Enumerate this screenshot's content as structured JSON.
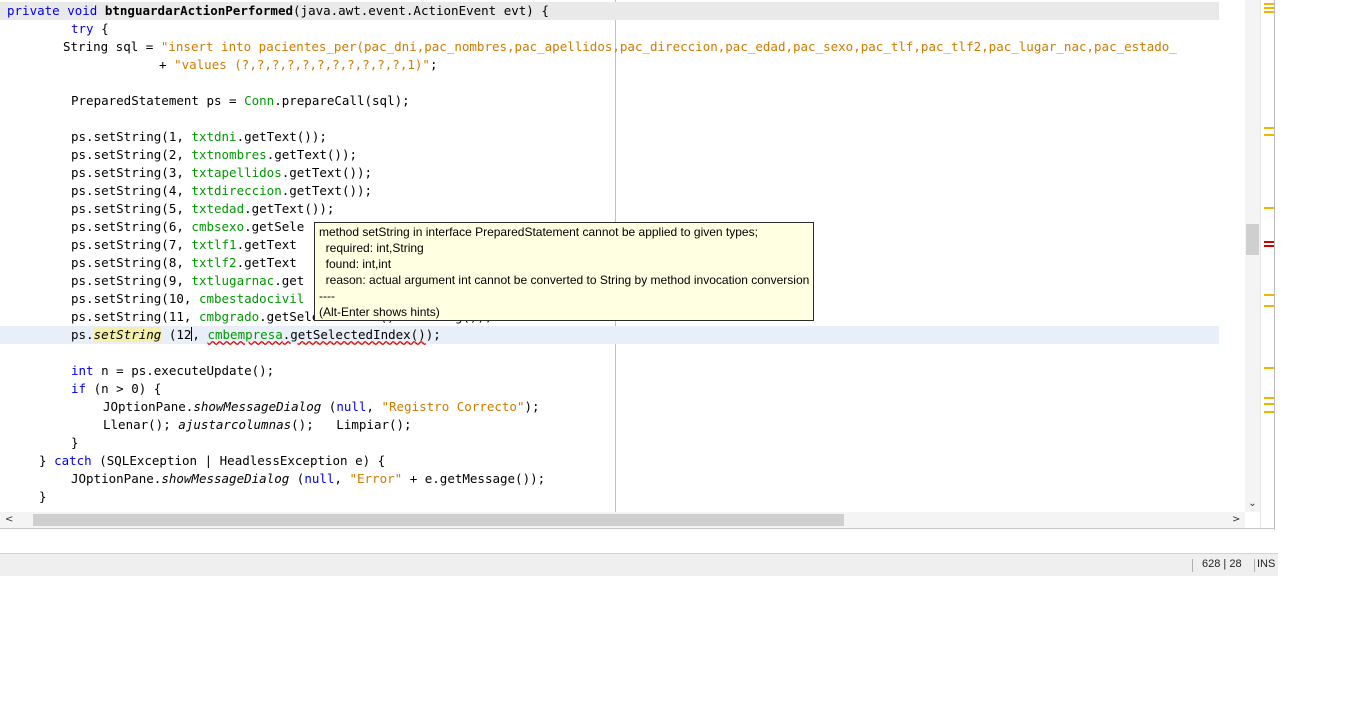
{
  "code": {
    "line1": {
      "kw1": "private",
      "kw2": "void",
      "method": "btnguardarActionPerformed",
      "rest": "(java.awt.event.ActionEvent evt) {"
    },
    "line2": {
      "kw": "try",
      "rest": " {"
    },
    "line3": {
      "plain": "String sql = ",
      "str": "\"insert into pacientes_per(pac_dni,pac_nombres,pac_apellidos,pac_direccion,pac_edad,pac_sexo,pac_tlf,pac_tlf2,pac_lugar_nac,pac_estado_"
    },
    "line4": {
      "plain": "+ ",
      "str": "\"values (?,?,?,?,?,?,?,?,?,?,?,1)\"",
      "end": ";"
    },
    "line6": {
      "pre": "PreparedStatement ps = ",
      "fld": "Conn",
      "post": ".prepareCall(sql);"
    },
    "stmts": [
      {
        "pre": "ps.setString(1, ",
        "fld": "txtdni",
        "post": ".getText());"
      },
      {
        "pre": "ps.setString(2, ",
        "fld": "txtnombres",
        "post": ".getText());"
      },
      {
        "pre": "ps.setString(3, ",
        "fld": "txtapellidos",
        "post": ".getText());"
      },
      {
        "pre": "ps.setString(4, ",
        "fld": "txtdireccion",
        "post": ".getText());"
      },
      {
        "pre": "ps.setString(5, ",
        "fld": "txtedad",
        "post": ".getText());"
      },
      {
        "pre": "ps.setString(6, ",
        "fld": "cmbsexo",
        "post": ".getSele"
      },
      {
        "pre": "ps.setString(7, ",
        "fld": "txtlf1",
        "post": ".getText"
      },
      {
        "pre": "ps.setString(8, ",
        "fld": "txtlf2",
        "post": ".getText"
      },
      {
        "pre": "ps.setString(9, ",
        "fld": "txtlugarnac",
        "post": ".get"
      },
      {
        "pre": "ps.setString(10, ",
        "fld": "cmbestadocivil",
        "post": ""
      },
      {
        "pre": "ps.setString(11, ",
        "fld": "cmbgrado",
        "post": ".getSelectedItem().toString());"
      }
    ],
    "line20": {
      "pre": "ps.",
      "method": "setString",
      "args": " (12",
      "comma": ", ",
      "fld": "cmbempresa",
      "err": ".getSelectedIndex()",
      "end": ");"
    },
    "line22": {
      "kw": "int",
      "rest": " n = ps.executeUpdate();"
    },
    "line23": {
      "kw": "if",
      "rest": " (n > 0) {"
    },
    "line24": {
      "pre": "JOptionPane.",
      "it": "showMessageDialog",
      "mid": " (",
      "kw": "null",
      "comma": ", ",
      "str": "\"Registro Correcto\"",
      "end": ");"
    },
    "line25": {
      "pre": "Llenar(); ",
      "it": "ajustarcolumnas",
      "post": "();   Limpiar();"
    },
    "line26": "}",
    "line27": {
      "pre": "} ",
      "kw": "catch",
      "post": " (SQLException | HeadlessException e) {"
    },
    "line28": {
      "pre": "JOptionPane.",
      "it": "showMessageDialog",
      "mid": " (",
      "kw": "null",
      "comma": ", ",
      "str": "\"Error\"",
      "end": " + e.getMessage());"
    },
    "line29": "}"
  },
  "tooltip": {
    "line1": "method setString in interface PreparedStatement cannot be applied to given types;",
    "line2": "  required: int,String",
    "line3": "  found: int,int",
    "line4": "  reason: actual argument int cannot be converted to String by method invocation conversion",
    "line5": "----",
    "line6": "(Alt-Enter shows hints)"
  },
  "status": {
    "position": "628 | 28",
    "mode": "INS"
  },
  "scroll": {
    "left": "<",
    "right": ">",
    "down": "⌄"
  },
  "colors": {
    "keyword": "#0000e6",
    "string": "#ce7b00",
    "field": "#009900",
    "warning_mark": "#f2b600",
    "error_mark": "#d00000",
    "tooltip_bg": "#ffffe1"
  }
}
